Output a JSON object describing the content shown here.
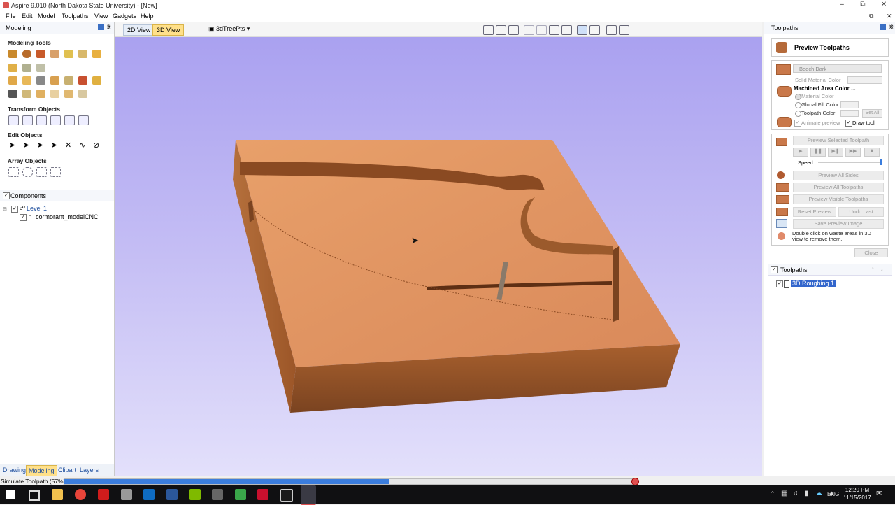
{
  "window": {
    "title": "Aspire 9.010 (North Dakota State University) - [New]"
  },
  "menu": [
    "File",
    "Edit",
    "Model",
    "Toolpaths",
    "View",
    "Gadgets",
    "Help"
  ],
  "left_panel": {
    "header": "Modeling",
    "sections": {
      "modeling_tools": "Modeling Tools",
      "transform_objects": "Transform Objects",
      "edit_objects": "Edit Objects",
      "array_objects": "Array Objects"
    },
    "components": {
      "title": "Components",
      "tree": [
        {
          "label": "Level 1"
        },
        {
          "label": "cormorant_modelCNC"
        }
      ]
    },
    "bottom_tabs": [
      "Drawing",
      "Modeling",
      "Clipart",
      "Layers"
    ]
  },
  "viewport": {
    "tabs": [
      "2D View",
      "3D View"
    ],
    "active_tab": "3D View",
    "layer_dropdown": "3dTreePts"
  },
  "right_panel": {
    "header": "Toolpaths",
    "preview_title": "Preview Toolpaths",
    "material": "Beech Dark",
    "solid_material_color": "Solid Material Color",
    "machined_area_color": "Machined Area Color ...",
    "material_color": "Material Color",
    "global_fill_color": "Global Fill Color",
    "toolpath_color": "Toolpath Color",
    "set_all": "Set All",
    "animate_preview": "Animate preview",
    "draw_tool": "Draw tool",
    "preview_selected": "Preview Selected Toolpath",
    "speed": "Speed",
    "speed_level": 1.0,
    "preview_all_sides": "Preview All Sides",
    "preview_all_toolpaths": "Preview All Toolpaths",
    "preview_visible_toolpaths": "Preview Visible Toolpaths",
    "reset_preview": "Reset Preview",
    "undo_last": "Undo Last",
    "save_preview_image": "Save Preview Image",
    "hint": "Double click on waste areas in 3D view to remove them.",
    "close": "Close",
    "toolpaths_list_title": "Toolpaths",
    "toolpaths": [
      "3D Roughing 1"
    ]
  },
  "status": {
    "text": "Simulate Toolpath (57%)",
    "progress": 0.57
  },
  "taskbar": {
    "lang": "ENG",
    "time": "12:20 PM",
    "date": "11/15/2017"
  },
  "colors": {
    "accent": "#ffe08a",
    "progress": "#3b7ddd",
    "wood_top": "#e0935e",
    "wood_side": "#a0562a"
  }
}
